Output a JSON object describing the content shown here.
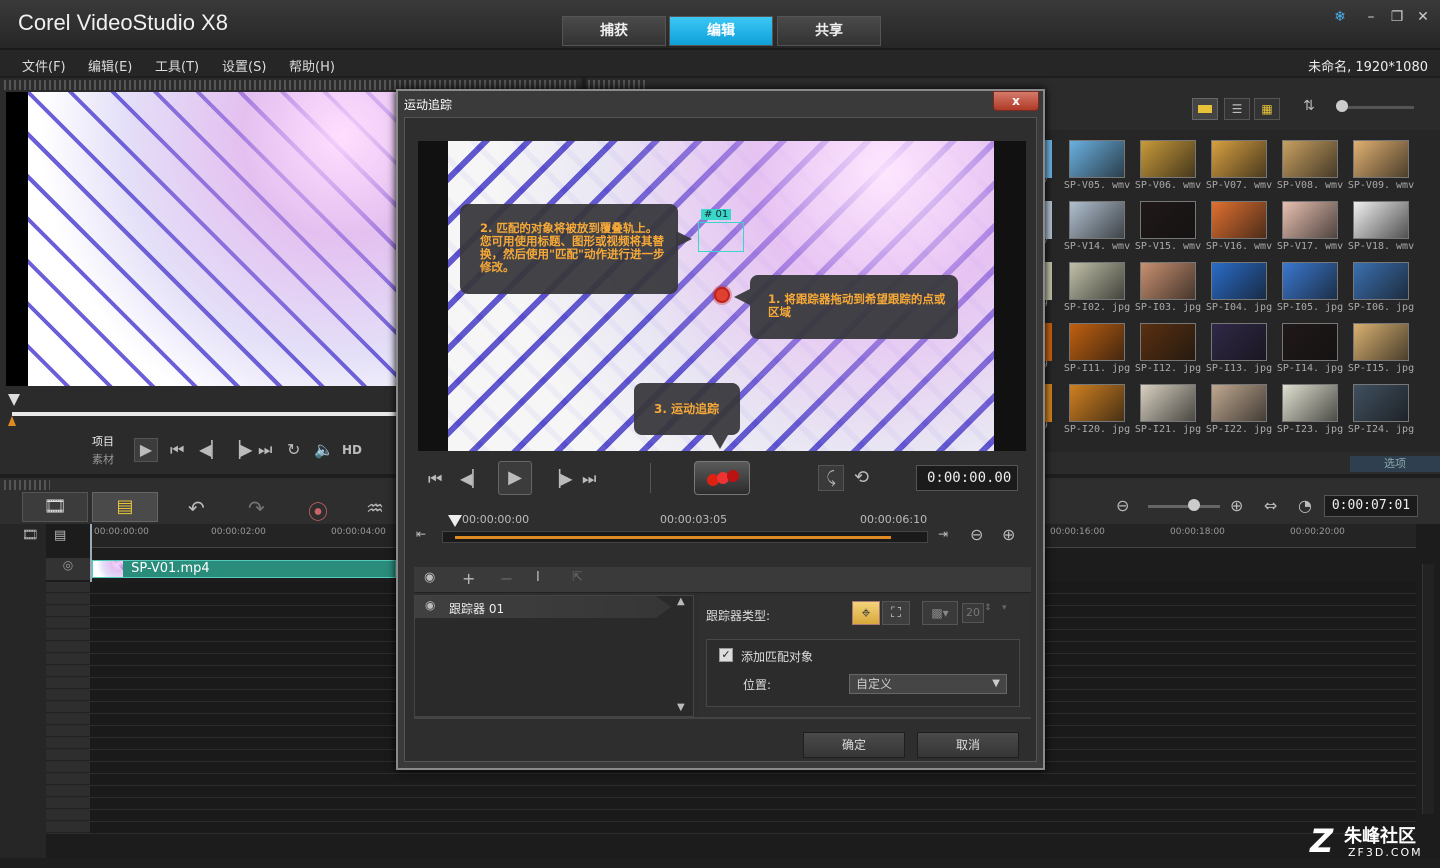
{
  "app": {
    "title": "Corel VideoStudio X8",
    "project_info": "未命名, 1920*1080"
  },
  "tabs": [
    "捕获",
    "编辑",
    "共享"
  ],
  "menu": [
    "文件(F)",
    "编辑(E)",
    "工具(T)",
    "设置(S)",
    "帮助(H)"
  ],
  "player": {
    "mode_project": "项目",
    "mode_clip": "素材",
    "hd_label": "HD"
  },
  "library": {
    "thumbs": [
      [
        "SP-V05. wmv",
        "SP-V06. wmv",
        "SP-V07. wmv",
        "SP-V08. wmv",
        "SP-V09. wmv"
      ],
      [
        "SP-V14. wmv",
        "SP-V15. wmv",
        "SP-V16. wmv",
        "SP-V17. wmv",
        "SP-V18. wmv"
      ],
      [
        "SP-I02. jpg",
        "SP-I03. jpg",
        "SP-I04. jpg",
        "SP-I05. jpg",
        "SP-I06. jpg"
      ],
      [
        "SP-I11. jpg",
        "SP-I12. jpg",
        "SP-I13. jpg",
        "SP-I14. jpg",
        "SP-I15. jpg"
      ],
      [
        "SP-I20. jpg",
        "SP-I21. jpg",
        "SP-I22. jpg",
        "SP-I23. jpg",
        "SP-I24. jpg"
      ]
    ],
    "left_labels": [
      "mv",
      "mv",
      "pg",
      "pg",
      "pg"
    ],
    "options_label": "选项"
  },
  "timeline": {
    "ruler": [
      "00:00:00:00",
      "00:00:02:00",
      "00:00:04:00"
    ],
    "ruler_right": [
      "00:00:16:00",
      "00:00:18:00",
      "00:00:20:00"
    ],
    "timecode": "0:00:07:01",
    "clip_name": "SP-V01.mp4"
  },
  "dialog": {
    "title": "运动追踪",
    "close": "x",
    "bubble1": "2. 匹配的对象将被放到覆叠轨上。您可用使用标题、图形或视频将其替换，然后使用\"匹配\"动作进行进一步修改。",
    "bubble2": "1. 将跟踪器拖动到希望跟踪的点或区域",
    "bubble3": "3. 运动追踪",
    "tracker_tag": "# 01",
    "timecode": "0:00:00.00",
    "ruler": [
      "00:00:00:00",
      "00:00:03:05",
      "00:00:06:10"
    ],
    "tracker_item": "跟踪器 01",
    "tracker_type_label": "跟踪器类型:",
    "size_value": "20",
    "add_match_label": "添加匹配对象",
    "position_label": "位置:",
    "position_value": "自定义",
    "ok": "确定",
    "cancel": "取消"
  },
  "watermark": {
    "brand": "朱峰社区",
    "url": "ZF3D.COM"
  }
}
